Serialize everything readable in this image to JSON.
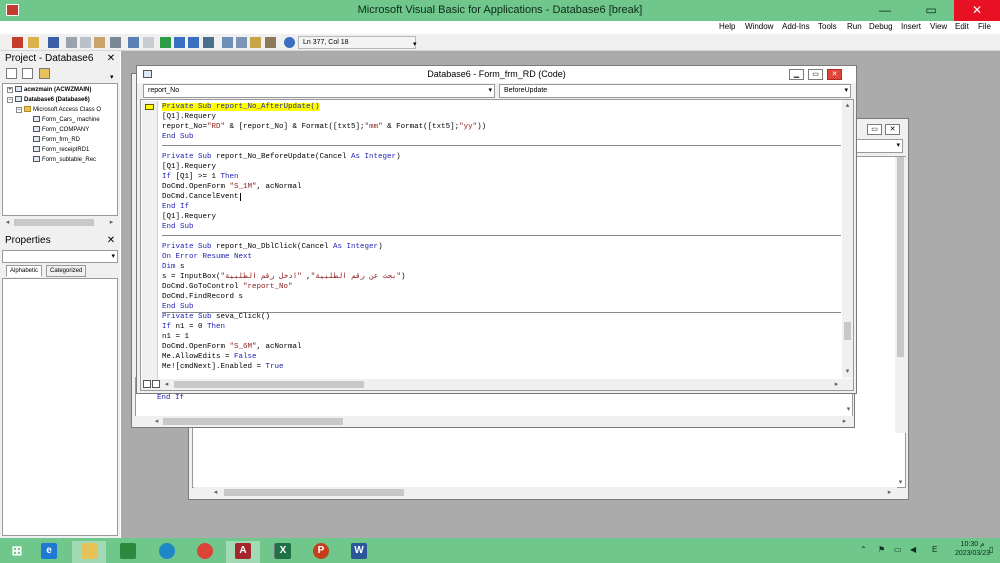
{
  "window": {
    "title": "Microsoft Visual Basic for Applications - Database6 [break]",
    "min": "—",
    "max": "▭",
    "close": "✕"
  },
  "menu": [
    "Help",
    "Window",
    "Add-Ins",
    "Tools",
    "Run",
    "Debug",
    "Insert",
    "View",
    "Edit",
    "File"
  ],
  "toolbar": {
    "position": "Ln 377, Col 18"
  },
  "project": {
    "title": "Project - Database6",
    "items": [
      {
        "label": "acwzmain (ACWZMAIN)"
      },
      {
        "label": "Database6 (Database6)"
      },
      {
        "label": "Microsoft Access Class O"
      },
      {
        "label": "Form_Cars_ machine"
      },
      {
        "label": "Form_COMPANY"
      },
      {
        "label": "Form_frm_RD"
      },
      {
        "label": "Form_receiptRD1"
      },
      {
        "label": "Form_subtable_Rec"
      }
    ]
  },
  "properties": {
    "title": "Properties",
    "tabs": [
      "Alphabetic",
      "Categorized"
    ]
  },
  "code_window": {
    "title": "Database6 - Form_frm_RD (Code)",
    "object_combo": "report_No",
    "proc_combo": "BeforeUpdate"
  },
  "code": {
    "l1": "Private Sub report_No_AfterUpdate()",
    "l2": "[Q1].Requery",
    "l3a": "report_No=",
    "l3b": "\"RD\"",
    "l3c": " & [report_No] & Format([txt5];",
    "l3d": "\"mm\"",
    "l3e": " & Format([txt5];",
    "l3f": "\"yy\"",
    "l3g": "))",
    "l4": "End Sub",
    "l5a": "Private Sub",
    "l5b": " report_No_BeforeUpdate(Cancel ",
    "l5c": "As Integer",
    "l5d": ")",
    "l6": "[Q1].Requery",
    "l7a": "If",
    "l7b": " [Q1] >= 1 ",
    "l7c": "Then",
    "l8a": "DoCmd.OpenForm ",
    "l8b": "\"S_1M\"",
    "l8c": ", acNormal",
    "l9": "DoCmd.CancelEvent",
    "l10": "End If",
    "l11": "[Q1].Requery",
    "l12": "End Sub",
    "l13a": "Private Sub",
    "l13b": " report_No_DblClick(Cancel ",
    "l13c": "As Integer",
    "l13d": ")",
    "l14": "On Error Resume Next",
    "l15a": "Dim",
    "l15b": " s",
    "l16a": "s = InputBox(",
    "l16b": "\"بحث عن رقم الطلبية\"",
    "l16c": ", ",
    "l16d": "\"ادخل رقم الطلبية\"",
    "l16e": ")",
    "l17a": "DoCmd.GoToControl ",
    "l17b": "\"report_No\"",
    "l18": "DoCmd.FindRecord s",
    "l19": "End Sub",
    "l20a": "Private Sub",
    "l20b": " seva_Click()",
    "l21a": "If",
    "l21b": " n1 = 0 ",
    "l21c": "Then",
    "l22": "n1 = 1",
    "l23a": "DoCmd.OpenForm ",
    "l23b": "\"S_6M\"",
    "l23c": ", acNormal",
    "l24a": "Me.AllowEdits = ",
    "l24b": "False",
    "l25a": "Me![cmdNext].Enabled = ",
    "l25b": "True",
    "back_l1": "End If"
  },
  "taskbar": {
    "time": "10:30 م",
    "date": "2023/03/23",
    "lang": "E"
  },
  "colors": {
    "chrome": "#6fc78c",
    "keyword": "#1f1fb3",
    "highlight": "#ffff00"
  }
}
